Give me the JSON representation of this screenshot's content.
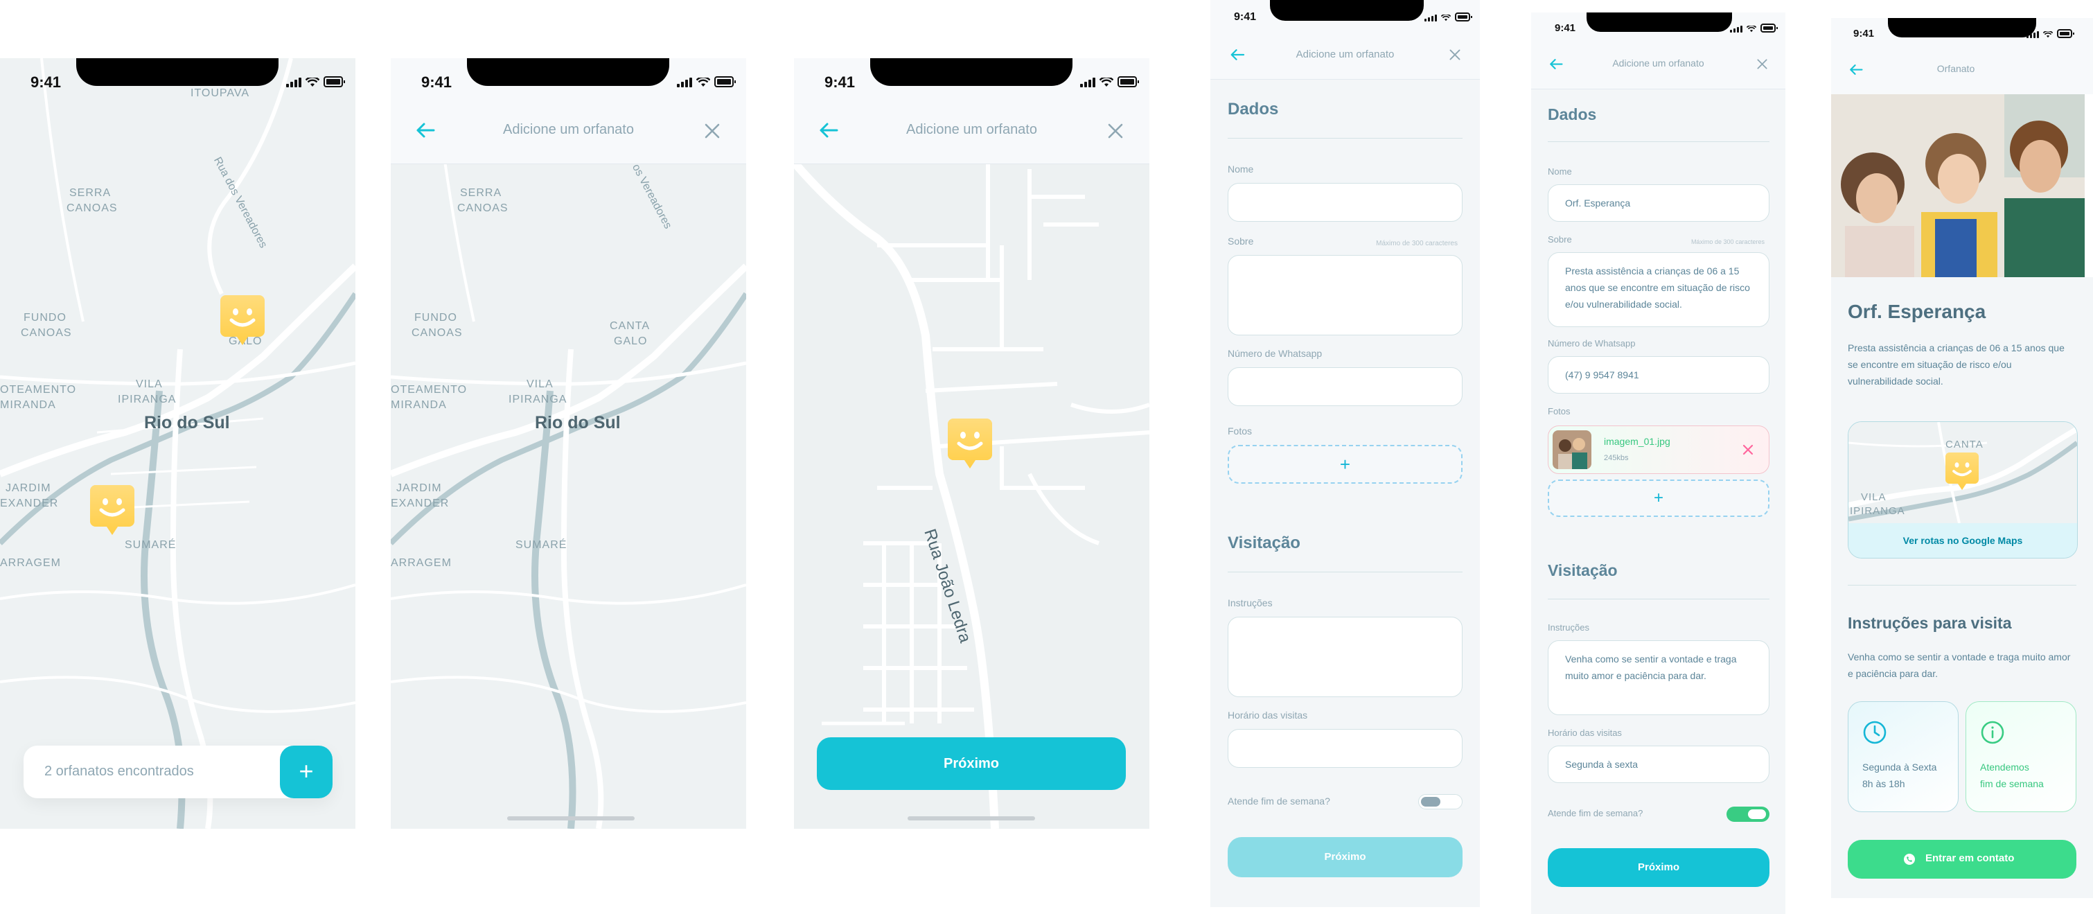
{
  "status_time": "9:41",
  "screen1": {
    "map_labels": [
      "ITOUPAVA",
      "Rua dos Vereadores",
      "SERRA",
      "CANOAS",
      "FUNDO",
      "CANOAS",
      "GALO",
      "OTEAMENTO",
      "MIRANDA",
      "VILA",
      "IPIRANGA",
      "Rio do Sul",
      "JARDIM",
      "EXANDER",
      "SUMARÉ",
      "ARRAGEM"
    ],
    "footer_text": "2 orfanatos encontrados",
    "add_label": "+"
  },
  "screen2": {
    "title": "Adicione um orfanato",
    "map_labels": [
      "SERRA",
      "CANOAS",
      "os Vereadores",
      "FUNDO",
      "CANOAS",
      "CANTA",
      "GALO",
      "OTEAMENTO",
      "MIRANDA",
      "VILA",
      "IPIRANGA",
      "Rio do Sul",
      "JARDIM",
      "EXANDER",
      "SUMARÉ",
      "ARRAGEM"
    ]
  },
  "screen3": {
    "title": "Adicione um orfanato",
    "street_label": "Rua João Ledra",
    "next_label": "Próximo"
  },
  "screen4": {
    "title": "Adicione um orfanato",
    "section_dados": "Dados",
    "label_nome": "Nome",
    "label_sobre": "Sobre",
    "hint_sobre": "Máximo de 300 caracteres",
    "label_whatsapp": "Número de Whatsapp",
    "label_fotos": "Fotos",
    "add_photo": "+",
    "section_visitacao": "Visitação",
    "label_instrucoes": "Instruções",
    "label_horario": "Horário das visitas",
    "label_fds": "Atende fim de semana?",
    "next_label": "Próximo"
  },
  "screen5": {
    "title": "Adicione um orfanato",
    "section_dados": "Dados",
    "label_nome": "Nome",
    "value_nome": "Orf. Esperança",
    "label_sobre": "Sobre",
    "hint_sobre": "Máximo de 300 caracteres",
    "value_sobre": "Presta assistência a crianças de 06 a 15 anos que se encontre em situação de risco e/ou vulnerabilidade social.",
    "label_whatsapp": "Número de Whatsapp",
    "value_whatsapp": "(47) 9 9547 8941",
    "label_fotos": "Fotos",
    "photo_name": "imagem_01.jpg",
    "photo_size": "245kbs",
    "add_photo": "+",
    "section_visitacao": "Visitação",
    "label_instrucoes": "Instruções",
    "value_instrucoes": "Venha como se sentir a vontade e traga muito amor e paciência para dar.",
    "label_horario": "Horário das visitas",
    "value_horario": "Segunda à sexta",
    "label_fds": "Atende fim de semana?",
    "next_label": "Próximo"
  },
  "screen6": {
    "title": "Orfanato",
    "name": "Orf. Esperança",
    "about": "Presta assistência a crianças de 06 a 15 anos que se encontre em situação de risco e/ou vulnerabilidade social.",
    "map_labels": [
      "CANTA",
      "VILA",
      "IPIRANGA"
    ],
    "map_link": "Ver rotas no Google Maps",
    "instructions_title": "Instruções para visita",
    "instructions": "Venha como se sentir a vontade e traga muito amor e paciência para dar.",
    "card_hours_line1": "Segunda à Sexta",
    "card_hours_line2": "8h às 18h",
    "card_weekend_line1": "Atendemos",
    "card_weekend_line2": "fim de semana",
    "contact_label": "Entrar em contato"
  },
  "colors": {
    "accent": "#15C3D6",
    "pin": "#FFD666",
    "green": "#39CC83",
    "text": "#4D6F80",
    "muted": "#8FA7B3"
  }
}
